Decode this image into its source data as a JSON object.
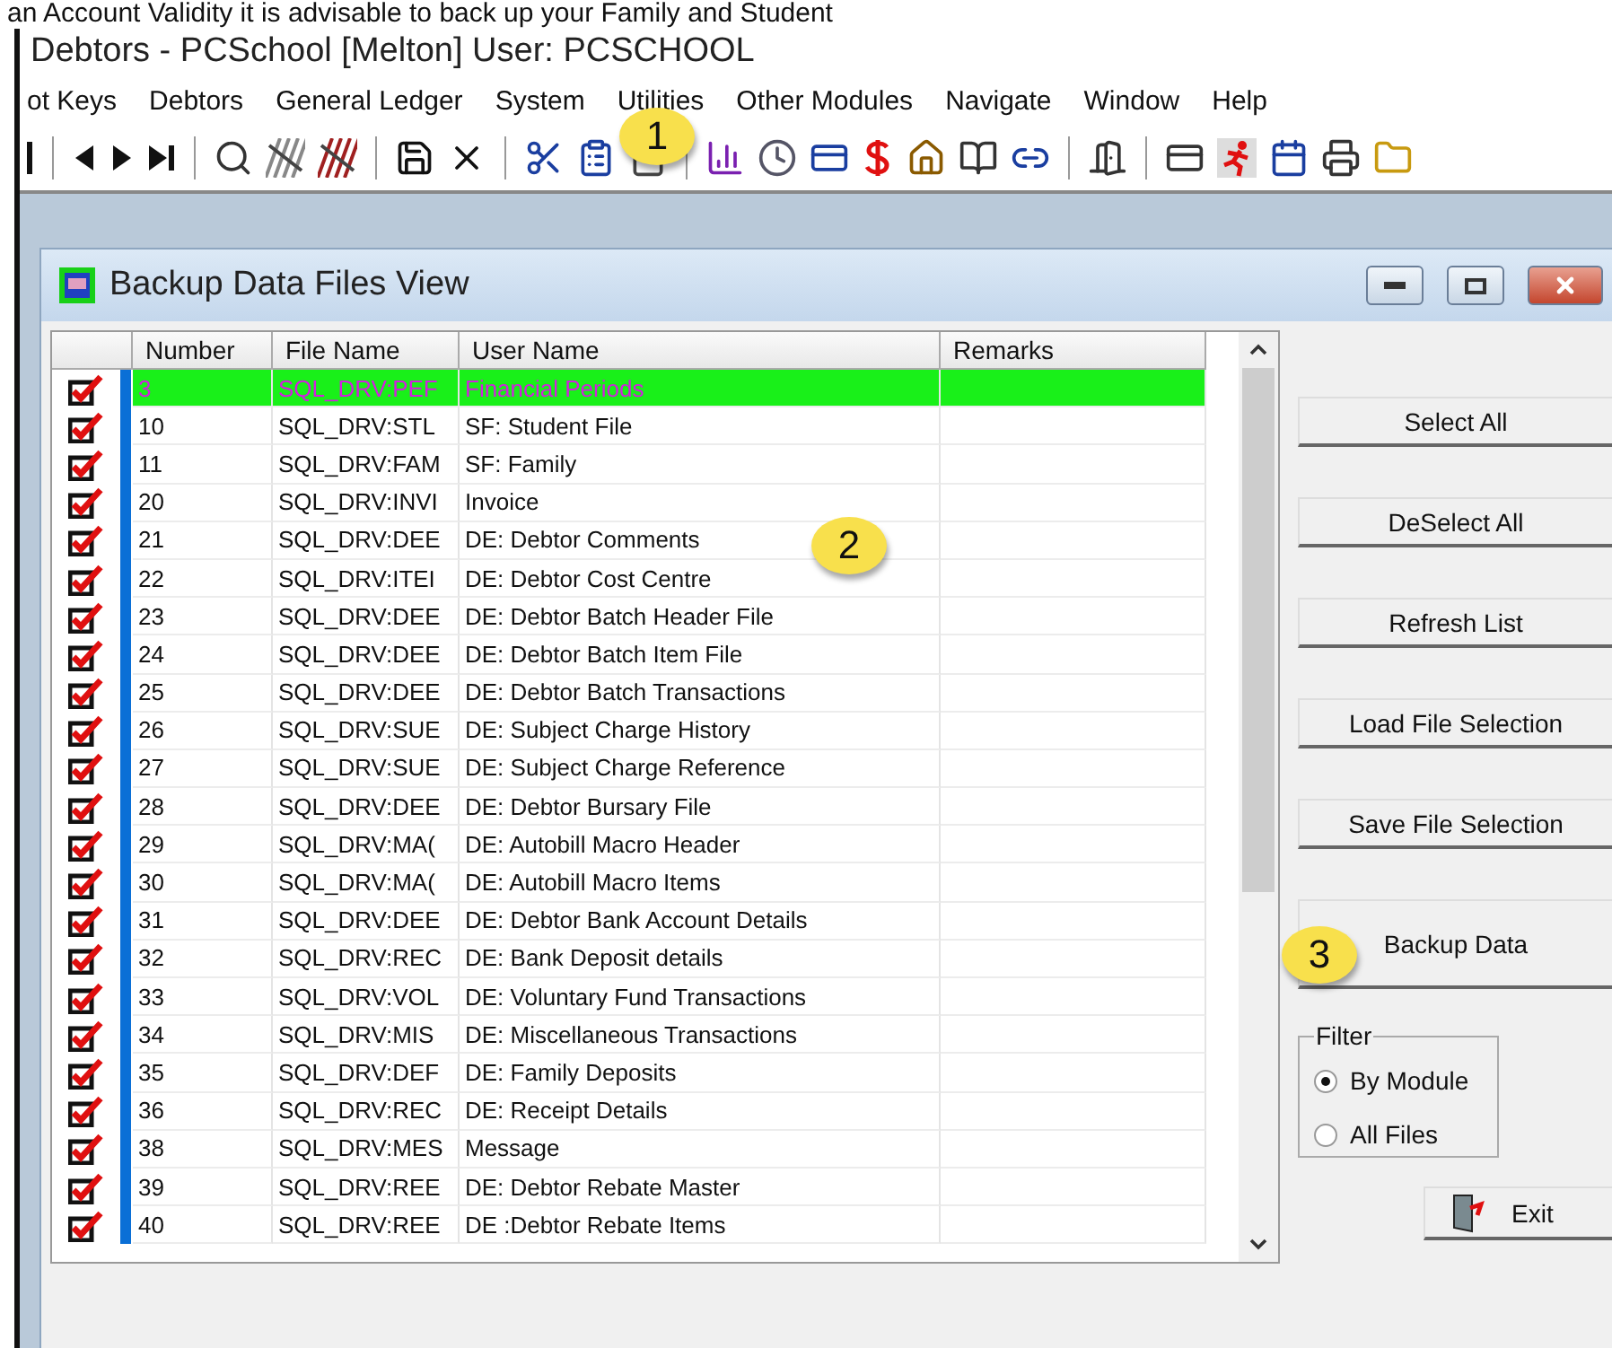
{
  "caption": "an Account Validity it is advisable to back up your Family and Student",
  "window": {
    "title": "Debtors - PCSchool [Melton]  User: PCSCHOOL"
  },
  "menu": [
    "ot Keys",
    "Debtors",
    "General Ledger",
    "System",
    "Utilities",
    "Other Modules",
    "Navigate",
    "Window",
    "Help"
  ],
  "dialog": {
    "title": "Backup Data Files View"
  },
  "table": {
    "columns": [
      "Number",
      "File Name",
      "User Name",
      "Remarks"
    ],
    "rows": [
      {
        "checked": true,
        "selected": true,
        "cells": [
          "3",
          "SQL_DRV:PEF",
          "Financial Periods"
        ]
      },
      {
        "checked": true,
        "selected": false,
        "cells": [
          "10",
          "SQL_DRV:STL",
          "SF: Student File"
        ]
      },
      {
        "checked": true,
        "selected": false,
        "cells": [
          "11",
          "SQL_DRV:FAM",
          "SF: Family"
        ]
      },
      {
        "checked": true,
        "selected": false,
        "cells": [
          "20",
          "SQL_DRV:INVI",
          "Invoice"
        ]
      },
      {
        "checked": true,
        "selected": false,
        "cells": [
          "21",
          "SQL_DRV:DEE",
          "DE: Debtor Comments"
        ]
      },
      {
        "checked": true,
        "selected": false,
        "cells": [
          "22",
          "SQL_DRV:ITEI",
          "DE: Debtor Cost Centre"
        ]
      },
      {
        "checked": true,
        "selected": false,
        "cells": [
          "23",
          "SQL_DRV:DEE",
          "DE: Debtor Batch Header File"
        ]
      },
      {
        "checked": true,
        "selected": false,
        "cells": [
          "24",
          "SQL_DRV:DEE",
          "DE: Debtor Batch Item File"
        ]
      },
      {
        "checked": true,
        "selected": false,
        "cells": [
          "25",
          "SQL_DRV:DEE",
          "DE: Debtor Batch Transactions"
        ]
      },
      {
        "checked": true,
        "selected": false,
        "cells": [
          "26",
          "SQL_DRV:SUE",
          "DE: Subject Charge History"
        ]
      },
      {
        "checked": true,
        "selected": false,
        "cells": [
          "27",
          "SQL_DRV:SUE",
          "DE: Subject Charge Reference"
        ]
      },
      {
        "checked": true,
        "selected": false,
        "cells": [
          "28",
          "SQL_DRV:DEE",
          "DE: Debtor Bursary File"
        ]
      },
      {
        "checked": true,
        "selected": false,
        "cells": [
          "29",
          "SQL_DRV:MA(",
          "DE: Autobill Macro Header"
        ]
      },
      {
        "checked": true,
        "selected": false,
        "cells": [
          "30",
          "SQL_DRV:MA(",
          "DE: Autobill Macro Items"
        ]
      },
      {
        "checked": true,
        "selected": false,
        "cells": [
          "31",
          "SQL_DRV:DEE",
          "DE: Debtor Bank Account Details"
        ]
      },
      {
        "checked": true,
        "selected": false,
        "cells": [
          "32",
          "SQL_DRV:REC",
          "DE: Bank Deposit details"
        ]
      },
      {
        "checked": true,
        "selected": false,
        "cells": [
          "33",
          "SQL_DRV:VOL",
          "DE: Voluntary Fund Transactions"
        ]
      },
      {
        "checked": true,
        "selected": false,
        "cells": [
          "34",
          "SQL_DRV:MIS",
          "DE: Miscellaneous Transactions"
        ]
      },
      {
        "checked": true,
        "selected": false,
        "cells": [
          "35",
          "SQL_DRV:DEF",
          "DE: Family Deposits"
        ]
      },
      {
        "checked": true,
        "selected": false,
        "cells": [
          "36",
          "SQL_DRV:REC",
          "DE: Receipt Details"
        ]
      },
      {
        "checked": true,
        "selected": false,
        "cells": [
          "38",
          "SQL_DRV:MES",
          "Message"
        ]
      },
      {
        "checked": true,
        "selected": false,
        "cells": [
          "39",
          "SQL_DRV:REE",
          "DE: Debtor Rebate Master"
        ]
      },
      {
        "checked": true,
        "selected": false,
        "cells": [
          "40",
          "SQL_DRV:REE",
          "DE :Debtor Rebate Items"
        ]
      }
    ]
  },
  "buttons": [
    "Select All",
    "DeSelect All",
    "Refresh List",
    "Load File Selection",
    "Save File Selection",
    "Backup Data"
  ],
  "filter": {
    "label": "Filter",
    "options": [
      {
        "label": "By Module",
        "selected": true
      },
      {
        "label": "All Files",
        "selected": false
      }
    ]
  },
  "exit_button": "Exit",
  "callouts": [
    "1",
    "2",
    "3"
  ]
}
